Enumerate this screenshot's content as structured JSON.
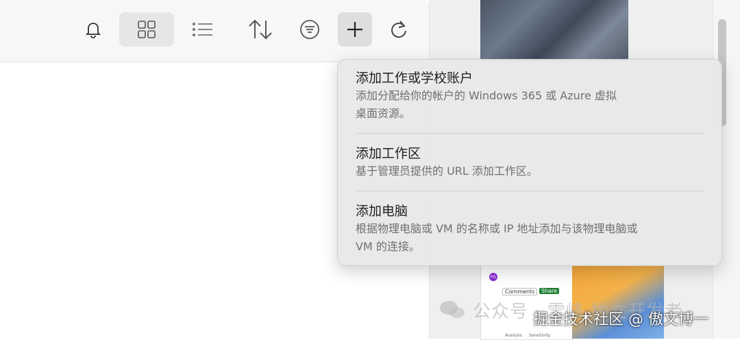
{
  "toolbar": {
    "icons": [
      "bell-icon",
      "grid-view-icon",
      "list-view-icon",
      "sort-icon",
      "filter-icon",
      "plus-icon",
      "refresh-icon"
    ]
  },
  "menu": {
    "items": [
      {
        "title": "添加工作或学校账户",
        "desc_line1": "添加分配给你的帐户的 Windows 365 或 Azure 虚拟",
        "desc_line2": "桌面资源。"
      },
      {
        "title": "添加工作区",
        "desc_line1": "基于管理员提供的 URL 添加工作区。",
        "desc_line2": ""
      },
      {
        "title": "添加电脑",
        "desc_line1": "根据物理电脑或 VM 的名称或 IP 地址添加与该物理电脑或",
        "desc_line2": "VM 的连接。"
      }
    ]
  },
  "thumbnail": {
    "avatar": "PG",
    "comments": "Comments",
    "share": "Share",
    "analysis": "Analysis",
    "sensitivity": "Sensitivity"
  },
  "watermark": {
    "line1": "公众号 · 雪峰 独立开发者",
    "line2": "掘金技术社区 @ 傲文博一"
  },
  "colors": {
    "toolbar_bg": "#f7f7f7",
    "popup_bg": "#e8e8e8",
    "active_button": "#e6e6e6"
  }
}
